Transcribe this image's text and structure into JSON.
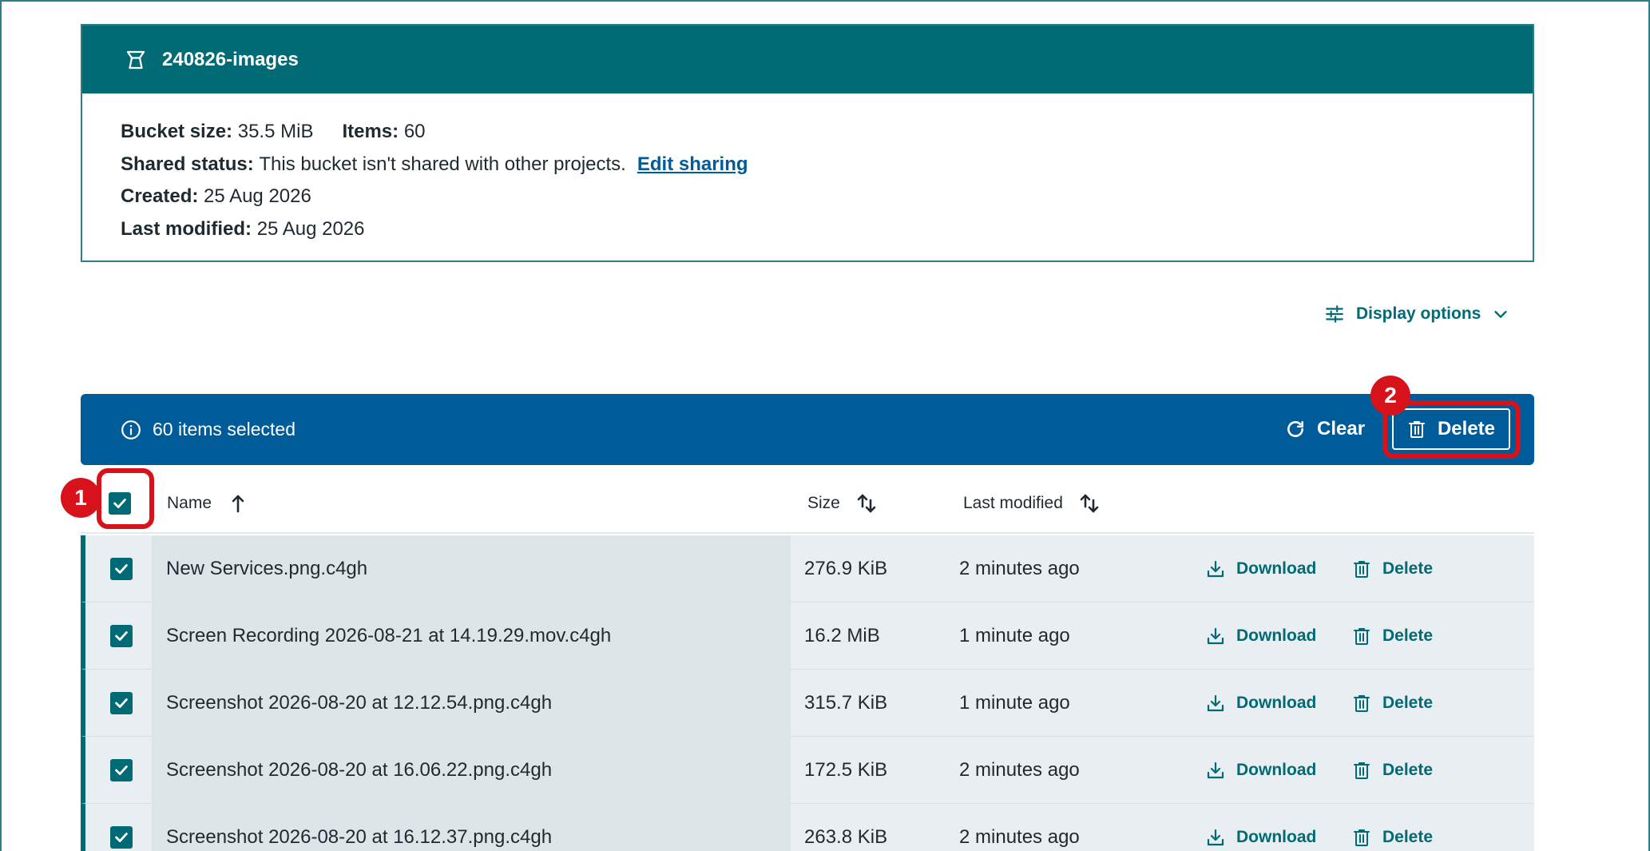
{
  "bucket": {
    "name": "240826-images",
    "size_label": "Bucket size:",
    "size_value": "35.5 MiB",
    "items_label": "Items:",
    "items_value": "60",
    "shared_label": "Shared status:",
    "shared_value": "This bucket isn't shared with other projects.",
    "edit_sharing": "Edit sharing",
    "created_label": "Created:",
    "created_value": "25 Aug 2026",
    "modified_label": "Last modified:",
    "modified_value": "25 Aug 2026"
  },
  "display_options": {
    "label": "Display options"
  },
  "selection": {
    "text": "60 items selected",
    "clear_label": "Clear",
    "delete_label": "Delete"
  },
  "annotations": {
    "badge_1": "1",
    "badge_2": "2"
  },
  "table": {
    "columns": {
      "name": "Name",
      "size": "Size",
      "modified": "Last modified"
    },
    "download_label": "Download",
    "delete_label": "Delete",
    "rows": [
      {
        "name": "New Services.png.c4gh",
        "size": "276.9 KiB",
        "modified": "2 minutes ago",
        "download": "Download",
        "delete": "Delete"
      },
      {
        "name": "Screen Recording 2026-08-21 at 14.19.29.mov.c4gh",
        "size": "16.2 MiB",
        "modified": "1 minute ago",
        "download": "Download",
        "delete": "Delete"
      },
      {
        "name": "Screenshot 2026-08-20 at 12.12.54.png.c4gh",
        "size": "315.7 KiB",
        "modified": "1 minute ago",
        "download": "Download",
        "delete": "Delete"
      },
      {
        "name": "Screenshot 2026-08-20 at 16.06.22.png.c4gh",
        "size": "172.5 KiB",
        "modified": "2 minutes ago",
        "download": "Download",
        "delete": "Delete"
      },
      {
        "name": "Screenshot 2026-08-20 at 16.12.37.png.c4gh",
        "size": "263.8 KiB",
        "modified": "2 minutes ago",
        "download": "Download",
        "delete": "Delete"
      }
    ]
  },
  "colors": {
    "teal": "#006a75",
    "blue": "#005c99",
    "annotation_red": "#d8121b",
    "row_bg": "#e8eef1"
  }
}
